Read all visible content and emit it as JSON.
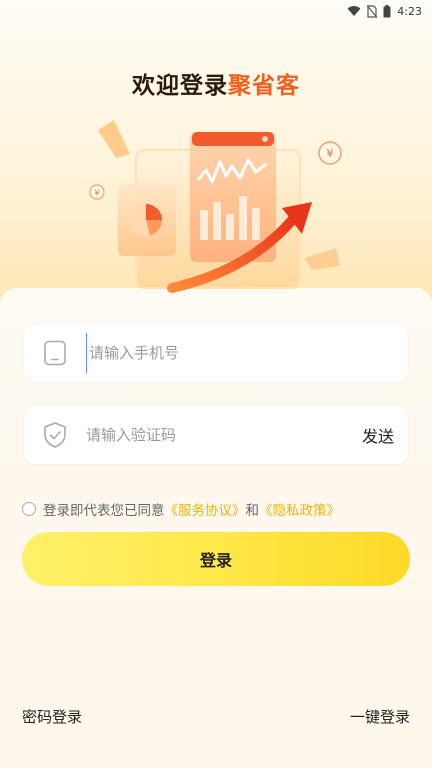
{
  "status_bar": {
    "time": "4:23"
  },
  "header": {
    "title_part1": "欢迎登录",
    "title_part2": "聚省客"
  },
  "form": {
    "phone_placeholder": "请输入手机号",
    "code_placeholder": "请输入验证码",
    "send_label": "发送"
  },
  "agreement": {
    "prefix": "登录即代表您已同意",
    "terms": "《服务协议》",
    "and": "和",
    "privacy": "《隐私政策》"
  },
  "login_button": "登录",
  "footer": {
    "password_login": "密码登录",
    "one_click_login": "一键登录"
  },
  "colors": {
    "accent_orange": "#f4601c",
    "link_yellow": "#f2b400",
    "button_yellow": "#ffe84a"
  }
}
